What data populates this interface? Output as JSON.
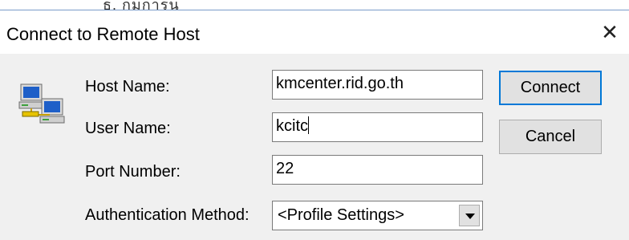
{
  "top_strip_text": "ธ.  กมการุน",
  "dialog": {
    "title": "Connect to Remote Host",
    "close_glyph": "✕"
  },
  "form": {
    "host_label": "Host Name:",
    "host_value": "kmcenter.rid.go.th",
    "user_label": "User Name:",
    "user_value": "kcitc",
    "port_label": "Port Number:",
    "port_value": "22",
    "auth_label": "Authentication Method:",
    "auth_value": "<Profile Settings>"
  },
  "buttons": {
    "connect": "Connect",
    "cancel": "Cancel"
  },
  "icons": {
    "host": "networked-computers-icon"
  }
}
